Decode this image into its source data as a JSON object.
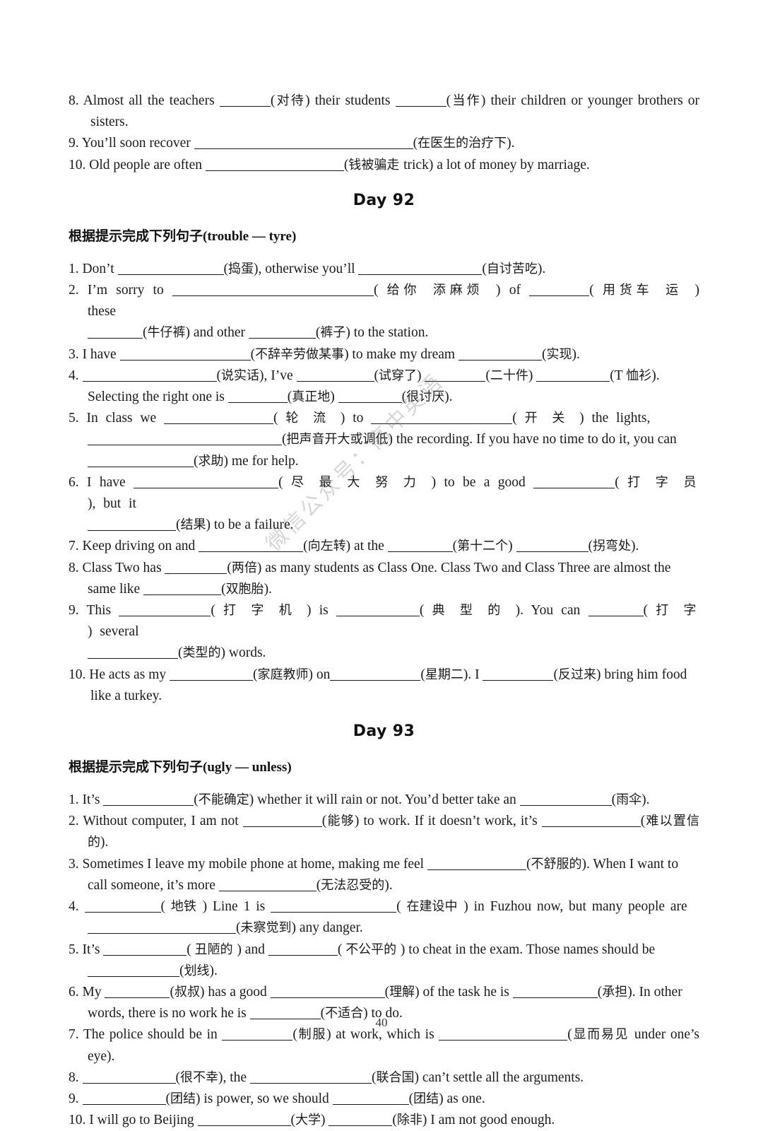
{
  "page": {
    "number": "40",
    "watermark": "微信公众号：高中英语"
  },
  "prev_section": {
    "items": [
      {
        "num": "8.",
        "parts": [
          {
            "t": "Almost all the teachers "
          },
          {
            "blank": 72
          },
          {
            "t": "(对待) their students "
          },
          {
            "blank": 72
          },
          {
            "t": "(当作) their children or younger brothers or sisters."
          }
        ]
      },
      {
        "num": "9.",
        "parts": [
          {
            "t": "You’ll soon recover "
          },
          {
            "blank": 310
          },
          {
            "t": "(在医生的治疗下)."
          }
        ]
      },
      {
        "num": "10.",
        "parts": [
          {
            "t": "Old people are often "
          },
          {
            "blank": 196
          },
          {
            "t": "(钱被骗走 trick) a lot of money by marriage."
          }
        ]
      }
    ]
  },
  "day92": {
    "title": "Day 92",
    "heading_cn": "根据提示完成下列句子",
    "heading_en": "(trouble — tyre)",
    "items": [
      {
        "num": "1.",
        "line1": [
          {
            "t": "Don’t "
          },
          {
            "blank": 150
          },
          {
            "t": "(捣蛋), otherwise you’ll "
          },
          {
            "blank": 175
          },
          {
            "t": "(自讨苦吃)."
          }
        ]
      },
      {
        "num": "2.",
        "line1": [
          {
            "t": "I’m sorry to "
          },
          {
            "blank": 285
          },
          {
            "t": "( 给你 添麻烦 ) of "
          },
          {
            "blank": 85
          },
          {
            "t": "( 用货车 运 ) these"
          }
        ],
        "line2": [
          {
            "blank": 78
          },
          {
            "t": "(牛仔裤) and other "
          },
          {
            "blank": 95
          },
          {
            "t": "(裤子) to the station."
          }
        ]
      },
      {
        "num": "3.",
        "line1": [
          {
            "t": "I have "
          },
          {
            "blank": 185
          },
          {
            "t": "(不辞辛劳做某事) to make my dream "
          },
          {
            "blank": 118
          },
          {
            "t": "(实现)."
          }
        ]
      },
      {
        "num": "4.",
        "line1": [
          {
            "blank": 190
          },
          {
            "t": "(说实话), I’ve "
          },
          {
            "blank": 110
          },
          {
            "t": "(试穿了) "
          },
          {
            "blank": 86
          },
          {
            "t": "(二十件) "
          },
          {
            "blank": 104
          },
          {
            "t": "(T 恤衫)."
          }
        ],
        "line2": [
          {
            "t": "Selecting the right one is "
          },
          {
            "blank": 84
          },
          {
            "t": "(真正地) "
          },
          {
            "blank": 90
          },
          {
            "t": "(很讨厌)."
          }
        ]
      },
      {
        "num": "5.",
        "line1": [
          {
            "t": "In class we "
          },
          {
            "blank": 155
          },
          {
            "t": "( 轮 流 ) to "
          },
          {
            "blank": 200
          },
          {
            "t": "( 开 关 ) the lights,"
          }
        ],
        "line2": [
          {
            "blank": 275
          },
          {
            "t": "(把声音开大或调低) the recording. If you have no time to do it, you can"
          }
        ],
        "line3": [
          {
            "blank": 150
          },
          {
            "t": "(求助) me for help."
          }
        ]
      },
      {
        "num": "6.",
        "line1": [
          {
            "t": "I have "
          },
          {
            "blank": 205
          },
          {
            "t": "( 尽 最 大 努 力 ) to be a good "
          },
          {
            "blank": 115
          },
          {
            "t": "( 打 字 员 ), but it"
          }
        ],
        "line2": [
          {
            "blank": 125
          },
          {
            "t": "(结果) to be a failure."
          }
        ]
      },
      {
        "num": "7.",
        "line1": [
          {
            "t": "Keep driving on and "
          },
          {
            "blank": 148
          },
          {
            "t": "(向左转) at the "
          },
          {
            "blank": 92
          },
          {
            "t": "(第十二个) "
          },
          {
            "blank": 102
          },
          {
            "t": "(拐弯处)."
          }
        ]
      },
      {
        "num": "8.",
        "line1": [
          {
            "t": "Class Two has "
          },
          {
            "blank": 88
          },
          {
            "t": "(两倍) as many students as Class One. Class Two and Class Three are almost the"
          }
        ],
        "line2": [
          {
            "t": "same like "
          },
          {
            "blank": 110
          },
          {
            "t": "(双胞胎)."
          }
        ]
      },
      {
        "num": "9.",
        "line1": [
          {
            "t": "This "
          },
          {
            "blank": 130
          },
          {
            "t": "( 打 字 机 ) is "
          },
          {
            "blank": 118
          },
          {
            "t": "( 典 型 的 ). You can "
          },
          {
            "blank": 78
          },
          {
            "t": "( 打 字 ) several"
          }
        ],
        "line2": [
          {
            "blank": 128
          },
          {
            "t": "(类型的) words."
          }
        ]
      },
      {
        "num": "10.",
        "line1": [
          {
            "t": "He acts as my "
          },
          {
            "blank": 118
          },
          {
            "t": "(家庭教师) on"
          },
          {
            "blank": 128
          },
          {
            "t": "(星期二). I "
          },
          {
            "blank": 100
          },
          {
            "t": "(反过来) bring him food"
          }
        ],
        "line2": [
          {
            "t": "like a turkey."
          }
        ]
      }
    ]
  },
  "day93": {
    "title": "Day 93",
    "heading_cn": "根据提示完成下列句子",
    "heading_en": "(ugly — unless)",
    "items": [
      {
        "num": "1.",
        "line1": [
          {
            "t": "It’s "
          },
          {
            "blank": 128
          },
          {
            "t": "(不能确定) whether it will rain or not. You’d better take an "
          },
          {
            "blank": 130
          },
          {
            "t": "(雨伞)."
          }
        ]
      },
      {
        "num": "2.",
        "line1": [
          {
            "t": "Without computer, I am not "
          },
          {
            "blank": 112
          },
          {
            "t": "(能够) to work. If it doesn’t work, it’s "
          },
          {
            "blank": 140
          },
          {
            "t": "(难以置信的)."
          }
        ]
      },
      {
        "num": "3.",
        "line1": [
          {
            "t": "Sometimes I leave my mobile phone at home, making me feel "
          },
          {
            "blank": 140
          },
          {
            "t": "(不舒服的). When I want to"
          }
        ],
        "line2": [
          {
            "t": "call someone, it’s more "
          },
          {
            "blank": 138
          },
          {
            "t": "(无法忍受的)."
          }
        ]
      },
      {
        "num": "4.",
        "line1": [
          {
            "blank": 108
          },
          {
            "t": "( 地铁 ) Line 1 is "
          },
          {
            "blank": 178
          },
          {
            "t": "( 在建设中 ) in Fuzhou now, but many people are"
          }
        ],
        "line2": [
          {
            "blank": 210
          },
          {
            "t": "(未察觉到) any danger."
          }
        ]
      },
      {
        "num": "5.",
        "line1": [
          {
            "t": "It’s "
          },
          {
            "blank": 118
          },
          {
            "t": "( 丑陋的 ) and "
          },
          {
            "blank": 98
          },
          {
            "t": "( 不公平的 ) to cheat in the exam. Those names should be"
          }
        ],
        "line2": [
          {
            "blank": 130
          },
          {
            "t": "(划线)."
          }
        ]
      },
      {
        "num": "6.",
        "line1": [
          {
            "t": "My "
          },
          {
            "blank": 92
          },
          {
            "t": "(叔叔) has a good "
          },
          {
            "blank": 162
          },
          {
            "t": "(理解) of the task he is "
          },
          {
            "blank": 120
          },
          {
            "t": "(承担). In other"
          }
        ],
        "line2": [
          {
            "t": "words, there is no work he is "
          },
          {
            "blank": 100
          },
          {
            "t": "(不适合) to do."
          }
        ]
      },
      {
        "num": "7.",
        "line1": [
          {
            "t": "The police should be in "
          },
          {
            "blank": 100
          },
          {
            "t": "(制服) at work, which is "
          },
          {
            "blank": 182
          },
          {
            "t": "(显而易见 under one’s eye)."
          }
        ]
      },
      {
        "num": "8.",
        "line1": [
          {
            "blank": 132
          },
          {
            "t": "(很不幸), the "
          },
          {
            "blank": 172
          },
          {
            "t": "(联合国) can’t settle all the arguments."
          }
        ]
      },
      {
        "num": "9.",
        "line1": [
          {
            "blank": 118
          },
          {
            "t": "(团结) is power, so we should "
          },
          {
            "blank": 108
          },
          {
            "t": "(团结) as one."
          }
        ]
      },
      {
        "num": "10.",
        "line1": [
          {
            "t": "I will go to Beijing "
          },
          {
            "blank": 132
          },
          {
            "t": "(大学) "
          },
          {
            "blank": 90
          },
          {
            "t": "(除非) I am not good enough."
          }
        ]
      }
    ]
  }
}
